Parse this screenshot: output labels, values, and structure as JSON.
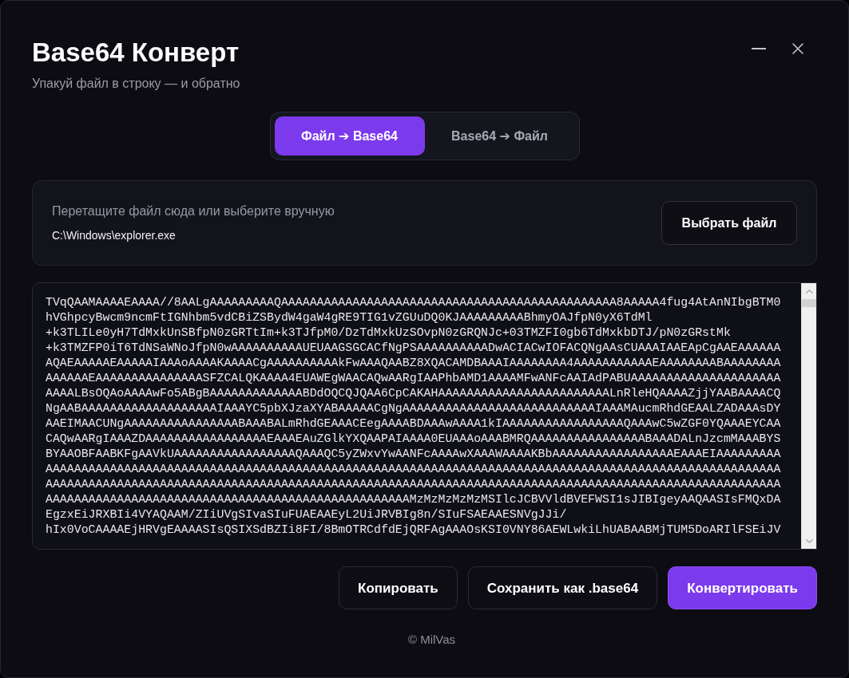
{
  "window": {
    "title": "Base64 Конверт",
    "subtitle": "Упакуй файл в строку — и обратно"
  },
  "mode_tabs": [
    {
      "label": "Файл ➔ Base64",
      "selected": true
    },
    {
      "label": "Base64 ➔ Файл",
      "selected": false
    }
  ],
  "file_picker": {
    "hint": "Перетащите файл сюда или выберите вручную",
    "path": "C:\\Windows\\explorer.exe",
    "button": "Выбрать файл"
  },
  "output": {
    "lines": [
      "TVqQAAMAAAAEAAAA//8AALgAAAAAAAAAQAAAAAAAAAAAAAAAAAAAAAAAAAAAAAAAAAAAAAAAAAAAAAAA8AAAAA4fug4AtAnNIbgBTM0",
      "hVGhpcyBwcm9ncmFtIGNhbm5vdCBiZSBydW4gaW4gRE9TIG1vZGUuDQ0KJAAAAAAAAABhmyOAJfpN0yX6TdMl",
      "+k3TLILe0yH7TdMxkUnSBfpN0zGRTtIm+k3TJfpM0/DzTdMxkUzSOvpN0zGRQNJc+03TMZFI0gb6TdMxkbDTJ/pN0zGRstMk",
      "+k3TMZFP0iT6TdNSaWNoJfpN0wAAAAAAAAAAUEUAAGSGCACfNgPSAAAAAAAAAADwACIACwIOFACQNgAAsCUAAAIAAEApCgAAEAAAAAA",
      "AQAEAAAAAEAAAAAIAAAoAAAAKAAAACgAAAAAAAAAAkFwAAAQAABZ8XQACAMDBAAAIAAAAAAAA4AAAAAAAAAAAEAAAAAAAABAAAAAAAA",
      "AAAAAAEAAAAAAAAAAAAAAASFZCALQKAAAA4EUAWEgWAACAQwAARgIAAPhbAMD1AAAAMFwANFcAAIAdPABUAAAAAAAAAAAAAAAAAAAAA",
      "AAAALBsOQAoAAAAwFo5ABgBAAAAAAAAAAAAABDdOQCQJQAA6CpCAKAHAAAAAAAAAAAAAAAAAAAAAAAALnRleHQAAAAZjjYAABAAAACQ",
      "NgAABAAAAAAAAAAAAAAAAAAAIAAAYC5pbXJzaXYABAAAAACgNgAAAAAAAAAAAAAAAAAAAAAAAAAAAIAAAMAucmRhdGEAALZADAAAsDY",
      "AAEIMAACUNgAAAAAAAAAAAAAAAABAAABALmRhdGEAAACEegAAAABDAAAwAAAA1kIAAAAAAAAAAAAAAAAAQAAAwC5wZGF0YQAAAEYCAA",
      "CAQwAARgIAAAZDAAAAAAAAAAAAAAAAAEAAAEAuZGlkYXQAAPAIAAAA0EUAAAoAAABMRQAAAAAAAAAAAAAAAABAAADALnJzcmMAAABYS",
      "BYAAOBFAABKFgAAVkUAAAAAAAAAAAAAAAAAQAAAQC5yZWxvYwAANFcAAAAwXAAAWAAAAKBbAAAAAAAAAAAAAAAAAEAAAEIAAAAAAAAA",
      "AAAAAAAAAAAAAAAAAAAAAAAAAAAAAAAAAAAAAAAAAAAAAAAAAAAAAAAAAAAAAAAAAAAAAAAAAAAAAAAAAAAAAAAAAAAAAAAAAAAAAAA",
      "AAAAAAAAAAAAAAAAAAAAAAAAAAAAAAAAAAAAAAAAAAAAAAAAAAAAAAAAAAAAAAAAAAAAAAAAAAAAAAAAAAAAAAAAAAAAAAAAAAAAAAA",
      "AAAAAAAAAAAAAAAAAAAAAAAAAAAAAAAAAAAAAAAAAAAAAAAAAAAMzMzMzMzMzMSIlcJCBVVldBVEFWSI1sJIBIgeyAAQAASIsFMQxDA",
      "EgzxEiJRXBIi4VYAQAAM/ZIiUVgSIvaSIuFUAEAAEyL2UiJRVBIg8n/SIuFSAEAAESNVgJJi/",
      "hIx0VoCAAAAEjHRVgEAAAASIsQSIXSdBZIi8FI/8BmOTRCdfdEjQRFAgAAAOsKSI0VNY86AEWLwkiLhUABAABMjTUM5DoARIlFSEiJV"
    ]
  },
  "actions": [
    {
      "label": "Копировать",
      "kind": "secondary"
    },
    {
      "label": "Сохранить как .base64",
      "kind": "secondary"
    },
    {
      "label": "Конвертировать",
      "kind": "primary"
    }
  ],
  "footer": "© MilVas"
}
